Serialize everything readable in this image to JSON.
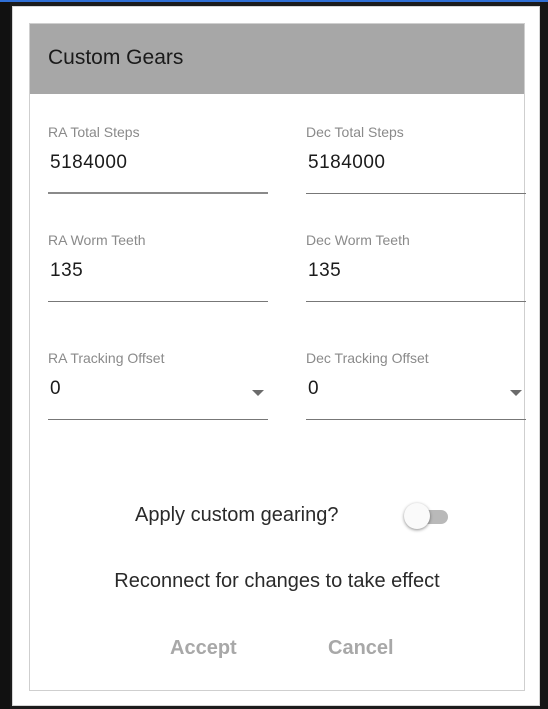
{
  "dialog": {
    "title": "Custom Gears",
    "fields": {
      "ra_total_steps": {
        "label": "RA Total Steps",
        "value": "5184000"
      },
      "dec_total_steps": {
        "label": "Dec Total Steps",
        "value": "5184000"
      },
      "ra_worm_teeth": {
        "label": "RA Worm Teeth",
        "value": "135"
      },
      "dec_worm_teeth": {
        "label": "Dec Worm Teeth",
        "value": "135"
      },
      "ra_tracking_offset": {
        "label": "RA Tracking Offset",
        "value": "0"
      },
      "dec_tracking_offset": {
        "label": "Dec Tracking Offset",
        "value": "0"
      }
    },
    "toggle": {
      "label": "Apply custom gearing?",
      "enabled": false
    },
    "notice": "Reconnect for changes to take effect",
    "buttons": {
      "accept": "Accept",
      "cancel": "Cancel"
    }
  }
}
